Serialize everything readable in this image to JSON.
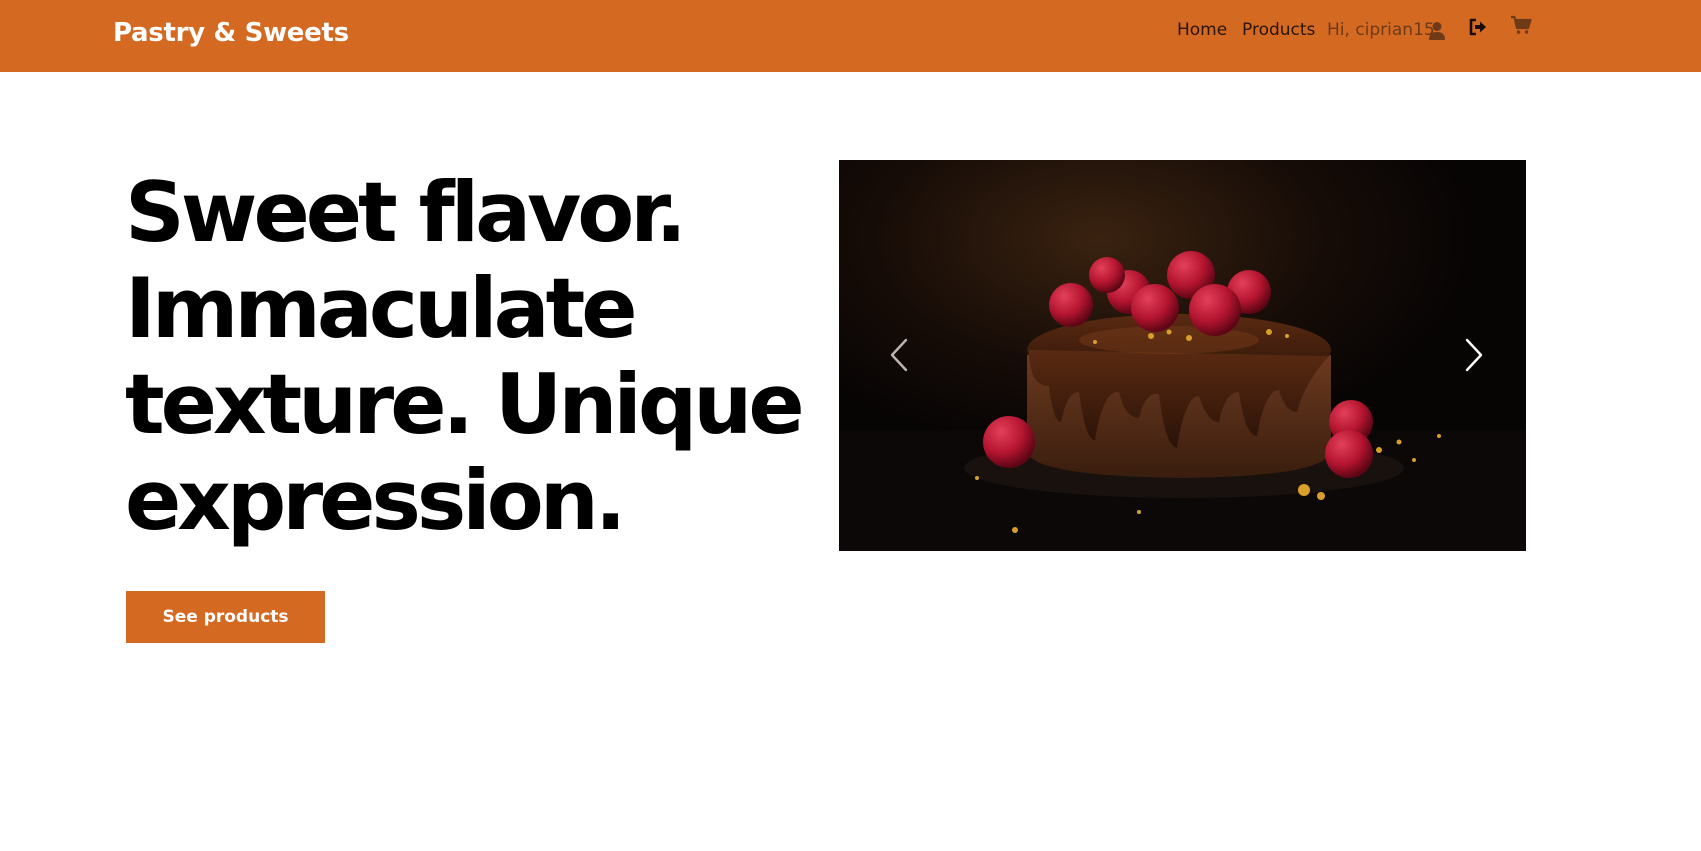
{
  "brand": "Pastry & Sweets",
  "nav": {
    "home": "Home",
    "products": "Products",
    "greeting": "Hi, ciprian15"
  },
  "icons": {
    "user": "user-icon",
    "logout": "logout-icon",
    "cart": "cart-icon",
    "prev": "chevron-left-icon",
    "next": "chevron-right-icon"
  },
  "hero": {
    "headline_lines": [
      "Sweet flavor.",
      "Immaculate",
      "texture. Unique",
      "expression."
    ],
    "cta_label": "See products"
  },
  "colors": {
    "brand": "#d46a22",
    "text": "#000000"
  }
}
